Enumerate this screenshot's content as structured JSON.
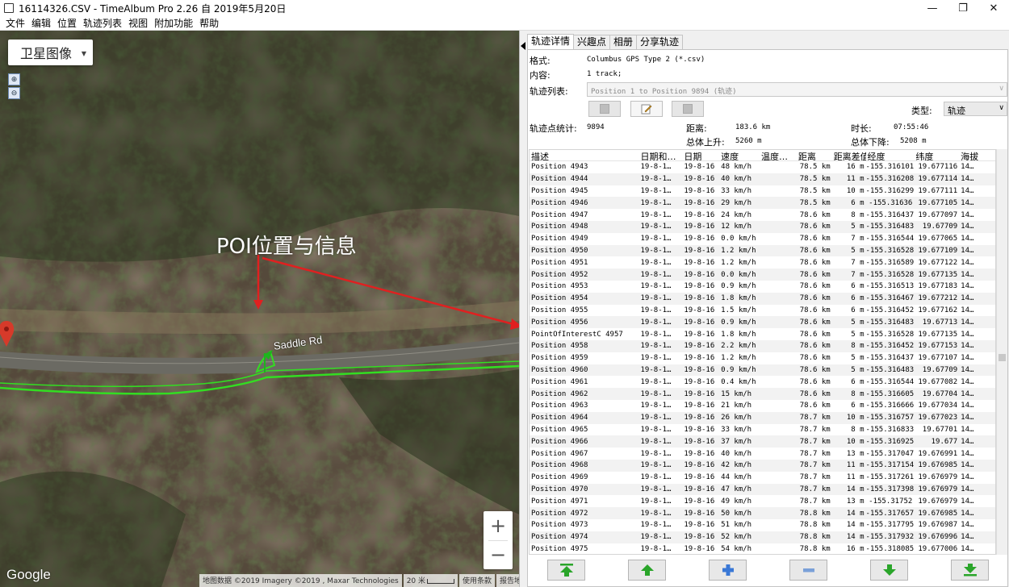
{
  "window": {
    "title": "16114326.CSV - TimeAlbum Pro 2.26 自 2019年5月20日",
    "controls": [
      "—",
      "❐",
      "✕"
    ]
  },
  "menu": [
    "文件",
    "编辑",
    "位置",
    "轨迹列表",
    "视图",
    "附加功能",
    "帮助"
  ],
  "map": {
    "layer_button": "卫星图像",
    "annotation": "POI位置与信息",
    "road_label": "Saddle Rd",
    "google_logo": "Google",
    "attribution": {
      "data": "地图数据 ©2019 Imagery ©2019 , Maxar Technologies",
      "scale": "20 米",
      "terms": "使用条款",
      "report": "报告地图错误"
    },
    "zoom_in": "+",
    "zoom_out": "−"
  },
  "panel": {
    "tabs": [
      "轨迹详情",
      "兴趣点",
      "相册",
      "分享轨迹"
    ],
    "format_label": "格式:",
    "format_value": "Columbus GPS Type 2 (*.csv)",
    "content_label": "内容:",
    "content_value": "1 track;",
    "track_list_label": "轨迹列表:",
    "track_list_value": "Position 1 to Position 9894 (轨迹)",
    "type_label": "类型:",
    "type_value": "轨迹",
    "stats": {
      "points_label": "轨迹点统计:",
      "points_value": "9894",
      "distance_label": "距离:",
      "distance_value": "183.6 km",
      "duration_label": "时长:",
      "duration_value": "07:55:46",
      "ascent_label": "总体上升:",
      "ascent_value": "5260 m",
      "descent_label": "总体下降:",
      "descent_value": "5208 m"
    }
  },
  "table": {
    "headers": [
      "描述",
      "日期和…",
      "日期",
      "速度",
      "温度…",
      "距离",
      "距离差值",
      "经度",
      "纬度",
      "海拔"
    ],
    "rows": [
      [
        "Position 4943",
        "19-8-1…",
        "19-8-16",
        "48 km/h",
        "",
        "78.5 km",
        "16 m",
        "-155.316101",
        "19.677116",
        "14…"
      ],
      [
        "Position 4944",
        "19-8-1…",
        "19-8-16",
        "40 km/h",
        "",
        "78.5 km",
        "11 m",
        "-155.316208",
        "19.677114",
        "14…"
      ],
      [
        "Position 4945",
        "19-8-1…",
        "19-8-16",
        "33 km/h",
        "",
        "78.5 km",
        "10 m",
        "-155.316299",
        "19.677111",
        "14…"
      ],
      [
        "Position 4946",
        "19-8-1…",
        "19-8-16",
        "29 km/h",
        "",
        "78.5 km",
        "6 m",
        "-155.31636",
        "19.677105",
        "14…"
      ],
      [
        "Position 4947",
        "19-8-1…",
        "19-8-16",
        "24 km/h",
        "",
        "78.6 km",
        "8 m",
        "-155.316437",
        "19.677097",
        "14…"
      ],
      [
        "Position 4948",
        "19-8-1…",
        "19-8-16",
        "12 km/h",
        "",
        "78.6 km",
        "5 m",
        "-155.316483",
        "19.67709",
        "14…"
      ],
      [
        "Position 4949",
        "19-8-1…",
        "19-8-16",
        "0.0 km/h",
        "",
        "78.6 km",
        "7 m",
        "-155.316544",
        "19.677065",
        "14…"
      ],
      [
        "Position 4950",
        "19-8-1…",
        "19-8-16",
        "1.2 km/h",
        "",
        "78.6 km",
        "5 m",
        "-155.316528",
        "19.677109",
        "14…"
      ],
      [
        "Position 4951",
        "19-8-1…",
        "19-8-16",
        "1.2 km/h",
        "",
        "78.6 km",
        "7 m",
        "-155.316589",
        "19.677122",
        "14…"
      ],
      [
        "Position 4952",
        "19-8-1…",
        "19-8-16",
        "0.0 km/h",
        "",
        "78.6 km",
        "7 m",
        "-155.316528",
        "19.677135",
        "14…"
      ],
      [
        "Position 4953",
        "19-8-1…",
        "19-8-16",
        "0.9 km/h",
        "",
        "78.6 km",
        "6 m",
        "-155.316513",
        "19.677183",
        "14…"
      ],
      [
        "Position 4954",
        "19-8-1…",
        "19-8-16",
        "1.8 km/h",
        "",
        "78.6 km",
        "6 m",
        "-155.316467",
        "19.677212",
        "14…"
      ],
      [
        "Position 4955",
        "19-8-1…",
        "19-8-16",
        "1.5 km/h",
        "",
        "78.6 km",
        "6 m",
        "-155.316452",
        "19.677162",
        "14…"
      ],
      [
        "Position 4956",
        "19-8-1…",
        "19-8-16",
        "0.9 km/h",
        "",
        "78.6 km",
        "5 m",
        "-155.316483",
        "19.67713",
        "14…"
      ],
      [
        "PointOfInterestC 4957",
        "19-8-1…",
        "19-8-16",
        "1.8 km/h",
        "",
        "78.6 km",
        "5 m",
        "-155.316528",
        "19.677135",
        "14…"
      ],
      [
        "Position 4958",
        "19-8-1…",
        "19-8-16",
        "2.2 km/h",
        "",
        "78.6 km",
        "8 m",
        "-155.316452",
        "19.677153",
        "14…"
      ],
      [
        "Position 4959",
        "19-8-1…",
        "19-8-16",
        "1.2 km/h",
        "",
        "78.6 km",
        "5 m",
        "-155.316437",
        "19.677107",
        "14…"
      ],
      [
        "Position 4960",
        "19-8-1…",
        "19-8-16",
        "0.9 km/h",
        "",
        "78.6 km",
        "5 m",
        "-155.316483",
        "19.67709",
        "14…"
      ],
      [
        "Position 4961",
        "19-8-1…",
        "19-8-16",
        "0.4 km/h",
        "",
        "78.6 km",
        "6 m",
        "-155.316544",
        "19.677082",
        "14…"
      ],
      [
        "Position 4962",
        "19-8-1…",
        "19-8-16",
        "15 km/h",
        "",
        "78.6 km",
        "8 m",
        "-155.316605",
        "19.67704",
        "14…"
      ],
      [
        "Position 4963",
        "19-8-1…",
        "19-8-16",
        "21 km/h",
        "",
        "78.6 km",
        "6 m",
        "-155.316666",
        "19.677034",
        "14…"
      ],
      [
        "Position 4964",
        "19-8-1…",
        "19-8-16",
        "26 km/h",
        "",
        "78.7 km",
        "10 m",
        "-155.316757",
        "19.677023",
        "14…"
      ],
      [
        "Position 4965",
        "19-8-1…",
        "19-8-16",
        "33 km/h",
        "",
        "78.7 km",
        "8 m",
        "-155.316833",
        "19.67701",
        "14…"
      ],
      [
        "Position 4966",
        "19-8-1…",
        "19-8-16",
        "37 km/h",
        "",
        "78.7 km",
        "10 m",
        "-155.316925",
        "19.677",
        "14…"
      ],
      [
        "Position 4967",
        "19-8-1…",
        "19-8-16",
        "40 km/h",
        "",
        "78.7 km",
        "13 m",
        "-155.317047",
        "19.676991",
        "14…"
      ],
      [
        "Position 4968",
        "19-8-1…",
        "19-8-16",
        "42 km/h",
        "",
        "78.7 km",
        "11 m",
        "-155.317154",
        "19.676985",
        "14…"
      ],
      [
        "Position 4969",
        "19-8-1…",
        "19-8-16",
        "44 km/h",
        "",
        "78.7 km",
        "11 m",
        "-155.317261",
        "19.676979",
        "14…"
      ],
      [
        "Position 4970",
        "19-8-1…",
        "19-8-16",
        "47 km/h",
        "",
        "78.7 km",
        "14 m",
        "-155.317398",
        "19.676979",
        "14…"
      ],
      [
        "Position 4971",
        "19-8-1…",
        "19-8-16",
        "49 km/h",
        "",
        "78.7 km",
        "13 m",
        "-155.31752",
        "19.676979",
        "14…"
      ],
      [
        "Position 4972",
        "19-8-1…",
        "19-8-16",
        "50 km/h",
        "",
        "78.8 km",
        "14 m",
        "-155.317657",
        "19.676985",
        "14…"
      ],
      [
        "Position 4973",
        "19-8-1…",
        "19-8-16",
        "51 km/h",
        "",
        "78.8 km",
        "14 m",
        "-155.317795",
        "19.676987",
        "14…"
      ],
      [
        "Position 4974",
        "19-8-1…",
        "19-8-16",
        "52 km/h",
        "",
        "78.8 km",
        "14 m",
        "-155.317932",
        "19.676996",
        "14…"
      ],
      [
        "Position 4975",
        "19-8-1…",
        "19-8-16",
        "54 km/h",
        "",
        "78.8 km",
        "16 m",
        "-155.318085",
        "19.677006",
        "14…"
      ]
    ]
  },
  "colors": {
    "track": "#33dd22",
    "annotation_arrow": "#e02020",
    "nav_arrow": "#2aa52a",
    "nav_plus": "#3a78d6",
    "marker": "#d63a2a"
  }
}
